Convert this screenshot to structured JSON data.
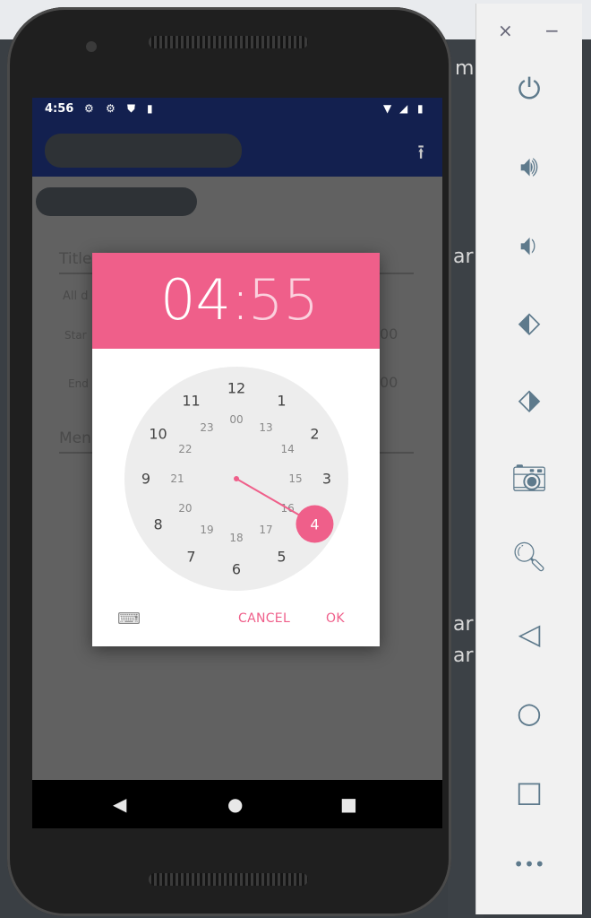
{
  "host": {
    "right_text_1": "m",
    "right_text_2": "ar",
    "right_text_3": "ar",
    "right_text_4": "ar"
  },
  "status_bar": {
    "time": "4:56",
    "icons": [
      "gear-icon",
      "gear-icon",
      "shield-icon",
      "sd-card-icon",
      "wifi-icon",
      "signal-icon",
      "battery-icon"
    ]
  },
  "app_bar": {
    "upload_icon": "upload-icon"
  },
  "form": {
    "title_label": "Title",
    "all_day_label": "All d",
    "start_label": "Star",
    "end_label": "End",
    "memo_label": "Men",
    "start_value_tail": "00",
    "end_value_tail": "00"
  },
  "time_picker": {
    "hour": "04",
    "separator": ":",
    "minute": "55",
    "selected_hour": "4",
    "outer_hours": [
      "12",
      "1",
      "2",
      "3",
      "4",
      "5",
      "6",
      "7",
      "8",
      "9",
      "10",
      "11"
    ],
    "inner_hours": [
      "00",
      "13",
      "14",
      "15",
      "16",
      "17",
      "18",
      "19",
      "20",
      "21",
      "22",
      "23"
    ],
    "cancel_label": "CANCEL",
    "ok_label": "OK",
    "accent_color": "#ef5f8a"
  },
  "nav_bar": {
    "back_icon": "back-triangle-icon",
    "home_icon": "home-circle-icon",
    "recents_icon": "recents-square-icon"
  },
  "emulator_panel": {
    "close_label": "×",
    "minimize_label": "−",
    "tools": [
      "power-icon",
      "volume-up-icon",
      "volume-down-icon",
      "rotate-left-icon",
      "rotate-right-icon",
      "camera-icon",
      "zoom-icon",
      "back-icon",
      "home-icon",
      "overview-icon",
      "more-icon"
    ],
    "more_label": "•••"
  }
}
